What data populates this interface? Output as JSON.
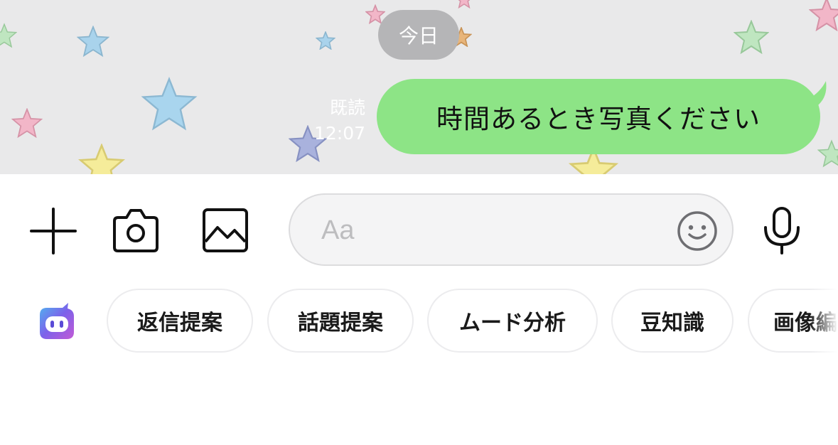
{
  "chat": {
    "date_label": "今日",
    "message": {
      "read_status": "既読",
      "time": "12:07",
      "text": "時間あるとき写真ください"
    }
  },
  "composer": {
    "placeholder": "Aa",
    "icons": [
      "plus-icon",
      "camera-icon",
      "image-icon",
      "emoji-icon",
      "microphone-icon"
    ]
  },
  "suggestions": {
    "icon": "ai-assistant-icon",
    "chips": [
      "返信提案",
      "話題提案",
      "ムード分析",
      "豆知識",
      "画像編"
    ]
  },
  "colors": {
    "bubble": "#8de486",
    "chat_background": "#e9e9ea",
    "date_pill": "#b5b5b7"
  }
}
